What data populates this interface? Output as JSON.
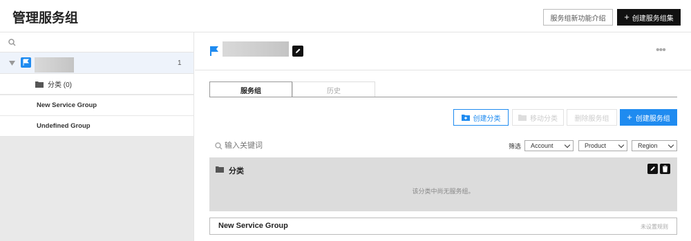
{
  "header": {
    "title": "管理服务组",
    "whats_new_label": "服务组新功能介绍",
    "create_set_label": "创建服务组集",
    "create_set_icon": "plus-icon"
  },
  "sidebar": {
    "search_icon": "search-icon",
    "root": {
      "name": "",
      "count": "1",
      "icon": "flag-icon"
    },
    "items": [
      {
        "label": "分类 (0)",
        "icon": "folder-icon"
      },
      {
        "label": "New Service Group"
      },
      {
        "label": "Undefined Group"
      }
    ]
  },
  "detail": {
    "name": "",
    "more_label": "•••",
    "tabs": [
      {
        "label": "服务组",
        "active": true
      },
      {
        "label": "历史",
        "active": false
      }
    ],
    "actions": {
      "create_category": "创建分类",
      "move_category": "移动分类",
      "delete_group": "删除服务组",
      "create_group": "创建服务组"
    },
    "search_placeholder": "输入关键词",
    "filter_label": "筛选",
    "filters": [
      "Account",
      "Product",
      "Region"
    ],
    "category": {
      "name": "分类",
      "empty_text": "该分类中尚无服务组。"
    },
    "group_row": {
      "name": "New Service Group",
      "status": "未设置规则"
    }
  },
  "colors": {
    "accent": "#1f8bf0",
    "dark": "#111111",
    "category_bg": "#dcdcdc"
  }
}
